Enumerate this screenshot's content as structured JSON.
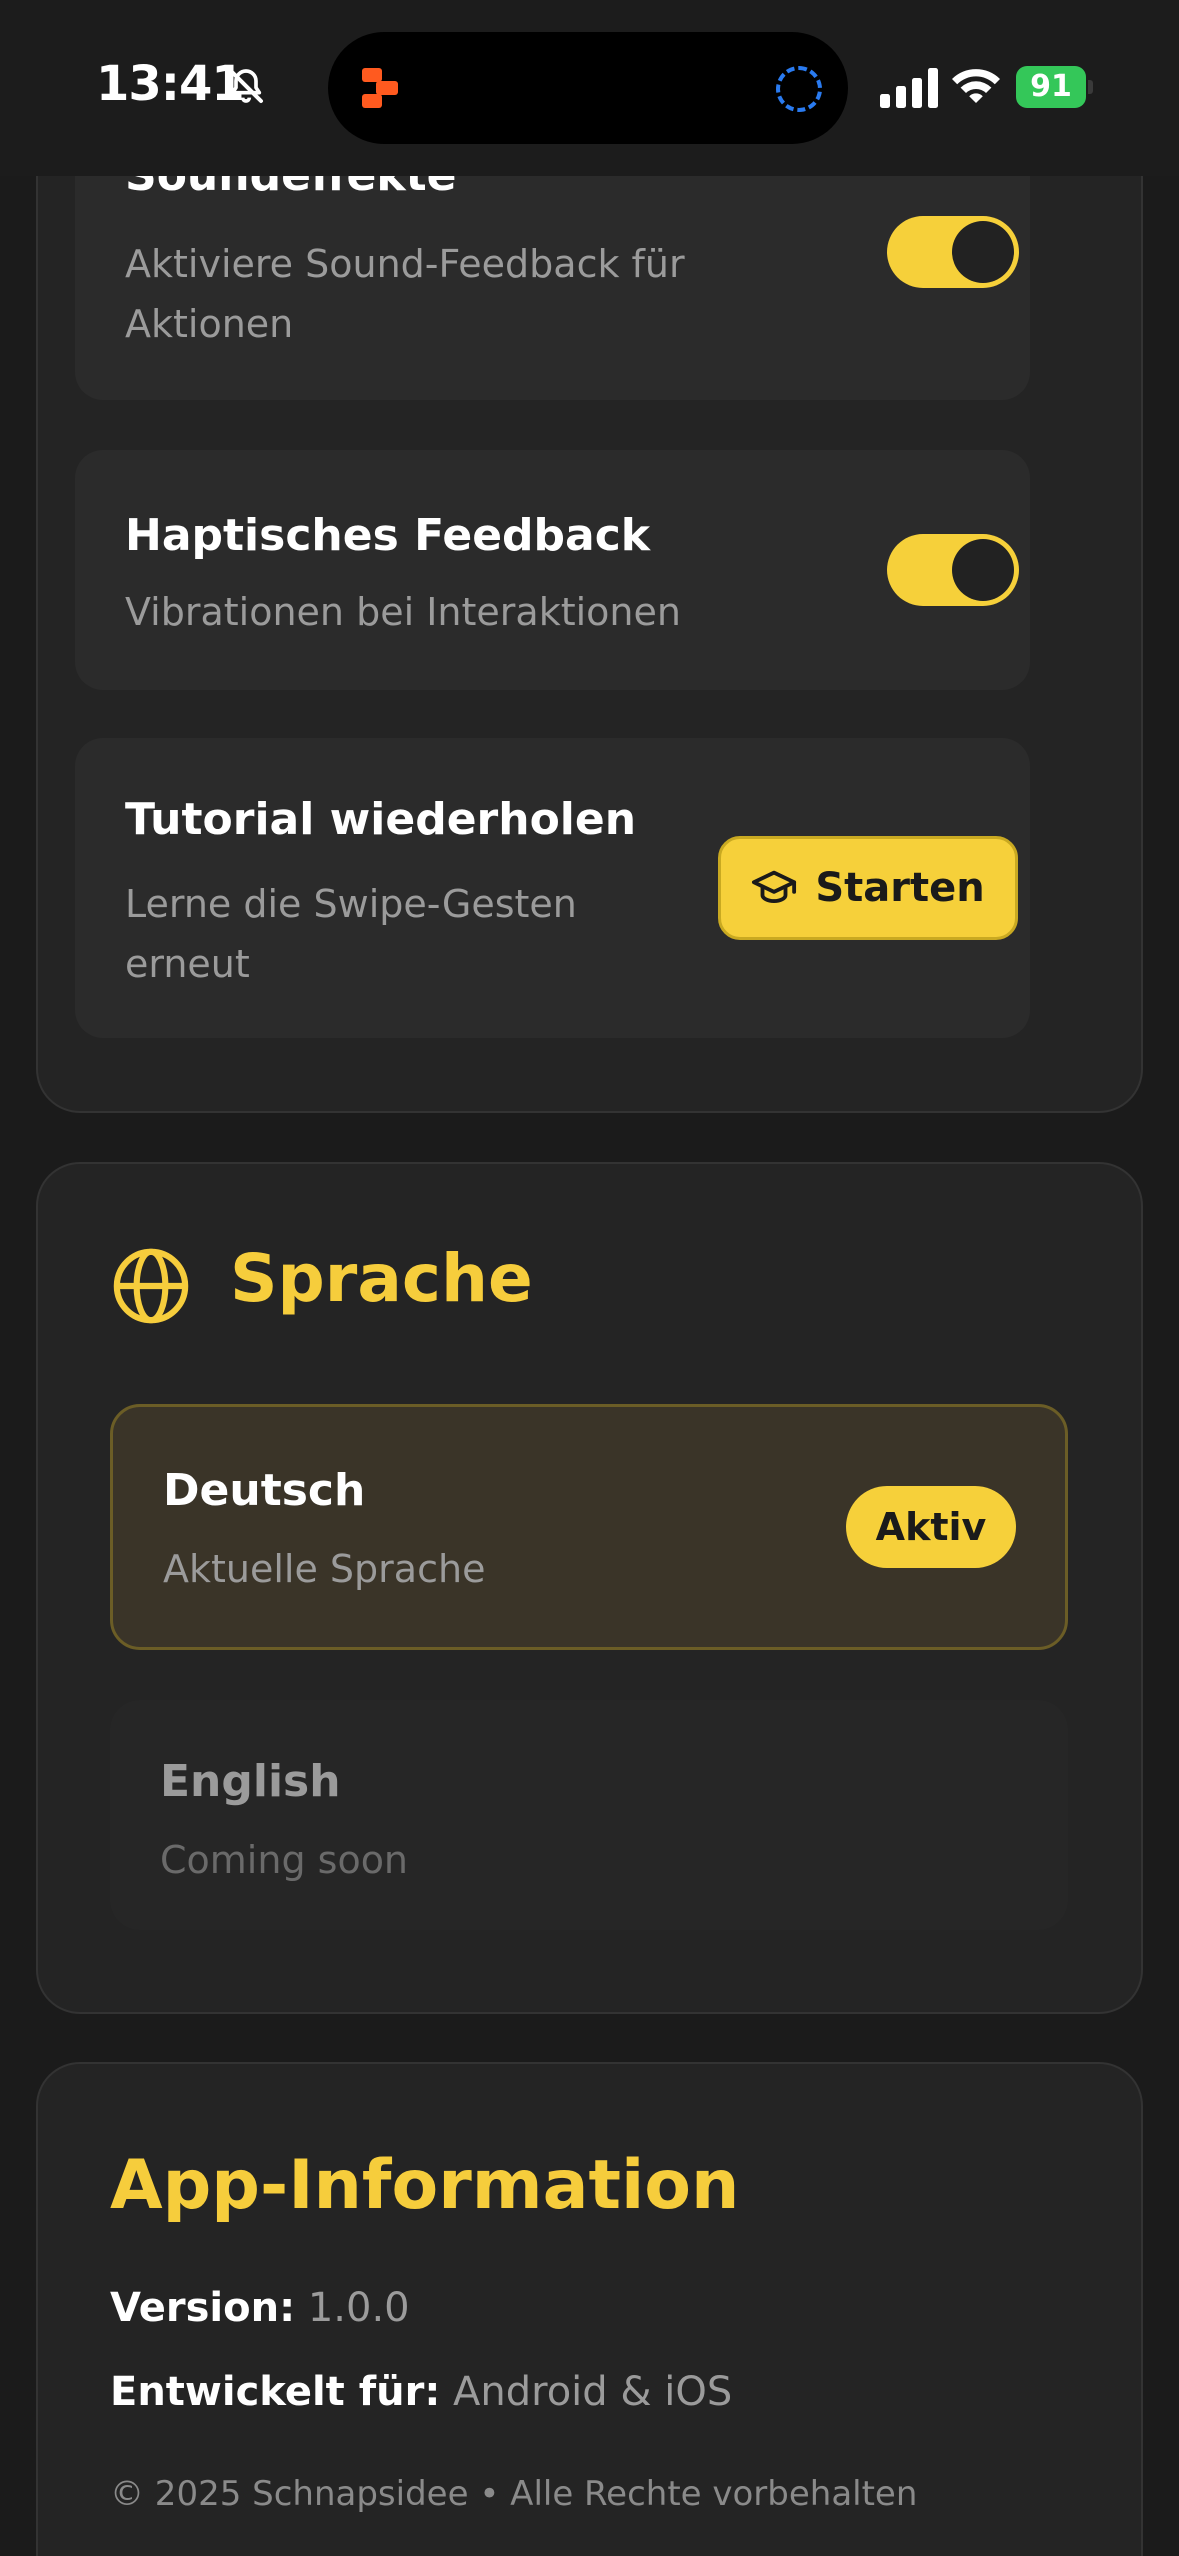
{
  "status_bar": {
    "time": "13:41",
    "battery": "91",
    "icons": [
      "bell-muted-icon",
      "app-activity-icon",
      "activity-ring-icon",
      "cellular-signal-icon",
      "wifi-icon",
      "battery-charging-icon"
    ],
    "battery_color": "#34c759"
  },
  "feedback_section": {
    "sound": {
      "title": "Soundeffekte",
      "description": "Aktiviere Sound-Feedback für Aktionen",
      "enabled": true
    },
    "haptic": {
      "title": "Haptisches Feedback",
      "description": "Vibrationen bei Interaktionen",
      "enabled": true
    },
    "tutorial": {
      "title": "Tutorial wiederholen",
      "description": "Lerne die Swipe-Gesten erneut",
      "button_label": "Starten",
      "button_icon": "graduation-cap-icon"
    }
  },
  "language_section": {
    "title": "Sprache",
    "icon": "globe-icon",
    "languages": [
      {
        "name": "Deutsch",
        "subtitle": "Aktuelle Sprache",
        "badge": "Aktiv"
      },
      {
        "name": "English",
        "subtitle": "Coming soon"
      }
    ]
  },
  "app_info": {
    "title": "App-Information",
    "version_label": "Version:",
    "version_value": "1.0.0",
    "platform_label": "Entwickelt für:",
    "platform_value": "Android & iOS",
    "copyright": "© 2025 Schnapsidee • Alle Rechte vorbehalten"
  },
  "colors": {
    "accent": "#f6d03a",
    "heading_accent": "#f6cd3c",
    "background": "#1b1b1b",
    "card": "#242424",
    "muted_text": "#9b9b9b"
  }
}
